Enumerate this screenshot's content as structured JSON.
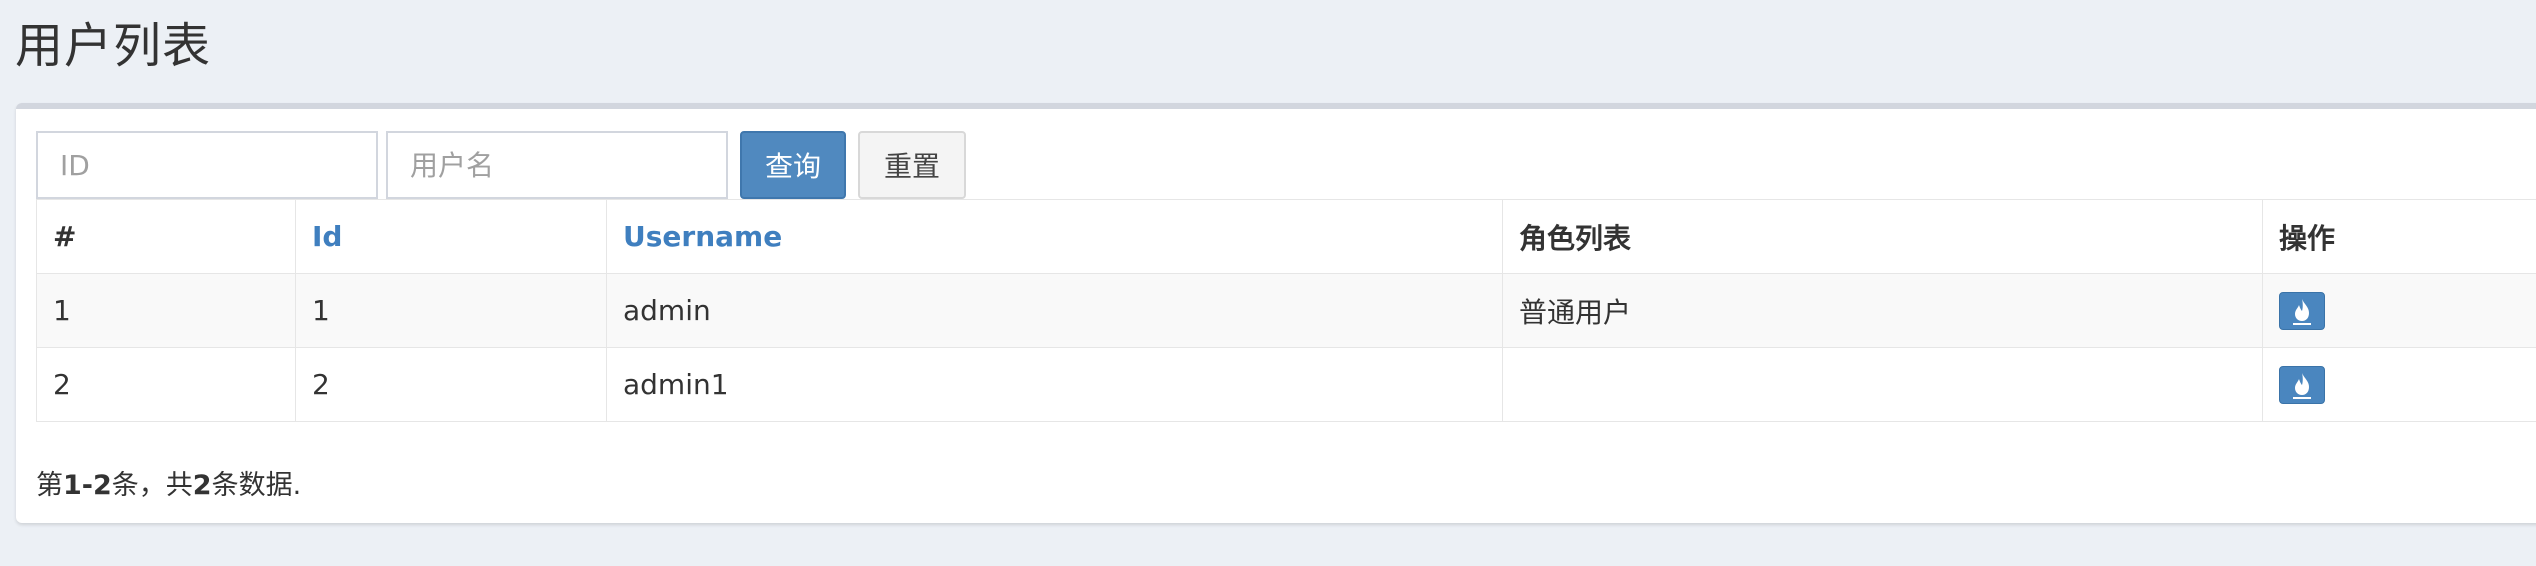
{
  "page": {
    "title": "用户列表"
  },
  "search": {
    "id_placeholder": "ID",
    "username_placeholder": "用户名",
    "query_label": "查询",
    "reset_label": "重置"
  },
  "table": {
    "headers": {
      "index": "#",
      "id": "Id",
      "username": "Username",
      "roles": "角色列表",
      "actions": "操作"
    },
    "rows": [
      {
        "index": "1",
        "id": "1",
        "username": "admin",
        "roles": "普通用户",
        "action_icon": "fire-icon"
      },
      {
        "index": "2",
        "id": "2",
        "username": "admin1",
        "roles": "",
        "action_icon": "fire-icon"
      }
    ]
  },
  "summary": {
    "prefix": "第",
    "range": "1-2",
    "middle": "条，共",
    "total": "2",
    "suffix": "条数据."
  },
  "colors": {
    "background": "#ecf0f5",
    "primary": "#5089bf",
    "sort_link": "#3f7fbf"
  }
}
